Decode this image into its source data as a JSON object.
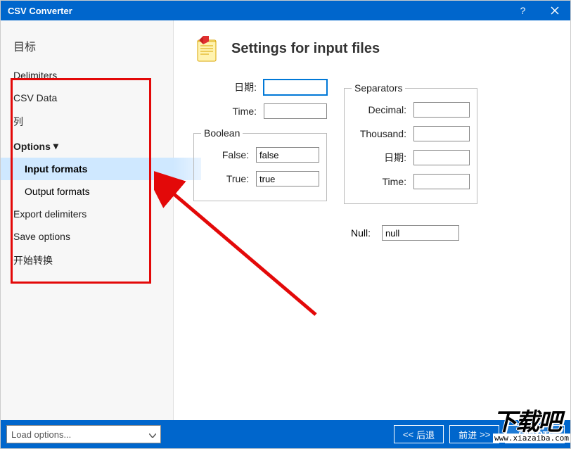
{
  "titlebar": {
    "title": "CSV Converter"
  },
  "sidebar": {
    "header": "目标",
    "items": {
      "delimiters": "Delimiters",
      "csvdata": "CSV Data",
      "columns": "列",
      "options": "Options",
      "input_formats": "Input formats",
      "output_formats": "Output formats",
      "export_delimiters": "Export delimiters",
      "save_options": "Save options",
      "start": "开始转换"
    }
  },
  "main": {
    "title": "Settings for input files",
    "date_label": "日期:",
    "time_label": "Time:",
    "boolean_legend": "Boolean",
    "false_label": "False:",
    "true_label": "True:",
    "false_value": "false",
    "true_value": "true",
    "separators_legend": "Separators",
    "decimal_label": "Decimal:",
    "thousand_label": "Thousand:",
    "sep_date_label": "日期:",
    "sep_time_label": "Time:",
    "null_label": "Null:",
    "null_value": "null"
  },
  "bottombar": {
    "load_options": "Load options...",
    "back": "后退",
    "forward": "前进",
    "start": "START!"
  },
  "watermark": {
    "main": "下载吧",
    "sub": "www.xiazaiba.com"
  }
}
